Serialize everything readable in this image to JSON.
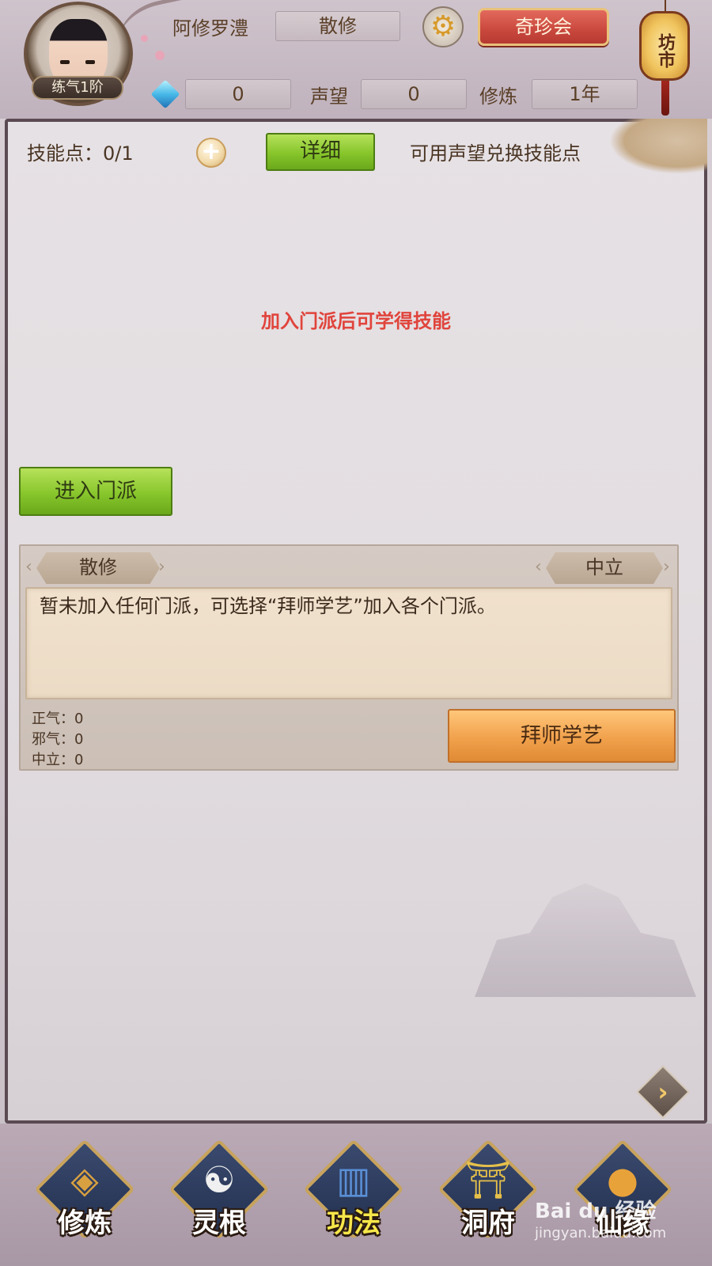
{
  "header": {
    "player_name": "阿修罗澧",
    "sect": "散修",
    "level": "练气1阶",
    "treasure_button": "奇珍会",
    "market_sign": "坊市",
    "gems": "0",
    "reputation_label": "声望",
    "reputation": "0",
    "cultivation_label": "修炼",
    "cultivation": "1年"
  },
  "skills": {
    "points_label": "技能点：0/1",
    "add_icon": "plus-icon",
    "detail_button": "详细",
    "exchange_hint": "可用声望兑换技能点",
    "join_hint": "加入门派后可学得技能",
    "enter_sect_button": "进入门派"
  },
  "sect_panel": {
    "sect_name": "散修",
    "alignment": "中立",
    "description": "暂未加入任何门派，可选择“拜师学艺”加入各个门派。",
    "righteous": "正气：0",
    "evil": "邪气：0",
    "neutral": "中立：0",
    "apprentice_button": "拜师学艺"
  },
  "nav": {
    "items": [
      {
        "label": "修炼",
        "icon": "monk-icon"
      },
      {
        "label": "灵根",
        "icon": "sword-yinyang-icon"
      },
      {
        "label": "功法",
        "icon": "book-icon",
        "active": true
      },
      {
        "label": "洞府",
        "icon": "pagoda-icon"
      },
      {
        "label": "仙缘",
        "icon": "gourd-icon"
      }
    ]
  },
  "watermark": {
    "main": "Bai du 经验",
    "sub": "jingyan.baidu.com"
  },
  "colors": {
    "accent_red": "#e0443c",
    "button_green": "#86c52b",
    "button_orange": "#f1a14c",
    "active_nav": "#f6e64a"
  }
}
